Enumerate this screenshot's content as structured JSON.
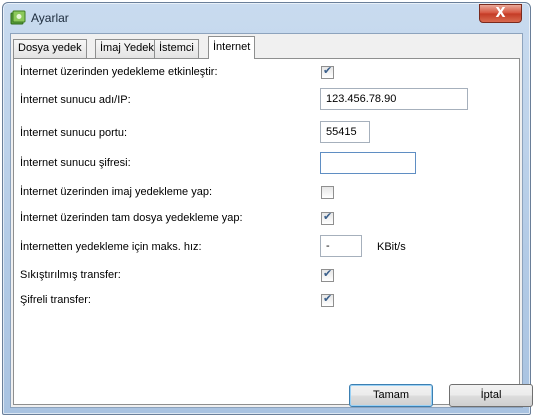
{
  "window": {
    "title": "Ayarlar",
    "close_label": "X",
    "app_icon": "settings-app-icon"
  },
  "tabs": [
    {
      "label": "Dosya yedek",
      "active": false
    },
    {
      "label": "İmaj Yedek",
      "active": false
    },
    {
      "label": "İstemci",
      "active": false
    },
    {
      "label": "İnternet",
      "active": true
    }
  ],
  "settings": {
    "enable_internet_backup": {
      "label": "İnternet üzerinden yedekleme etkinleştir:",
      "checked": true
    },
    "server_name": {
      "label": "İnternet sunucu adı/IP:",
      "value": "123.456.78.90"
    },
    "server_port": {
      "label": "İnternet sunucu portu:",
      "value": "55415"
    },
    "server_password": {
      "label": "İnternet sunucu şifresi:",
      "value": ""
    },
    "image_backup": {
      "label": "İnternet üzerinden imaj yedekleme yap:",
      "checked": false
    },
    "full_file_backup": {
      "label": "İnternet üzerinden tam dosya yedekleme yap:",
      "checked": true
    },
    "max_speed": {
      "label": "İnternetten yedekleme için maks. hız:",
      "value": "-",
      "unit": "KBit/s"
    },
    "compressed_transfer": {
      "label": "Sıkıştırılmış transfer:",
      "checked": true
    },
    "encrypted_transfer": {
      "label": "Şifreli transfer:",
      "checked": true
    }
  },
  "buttons": {
    "ok": "Tamam",
    "cancel": "İptal"
  }
}
